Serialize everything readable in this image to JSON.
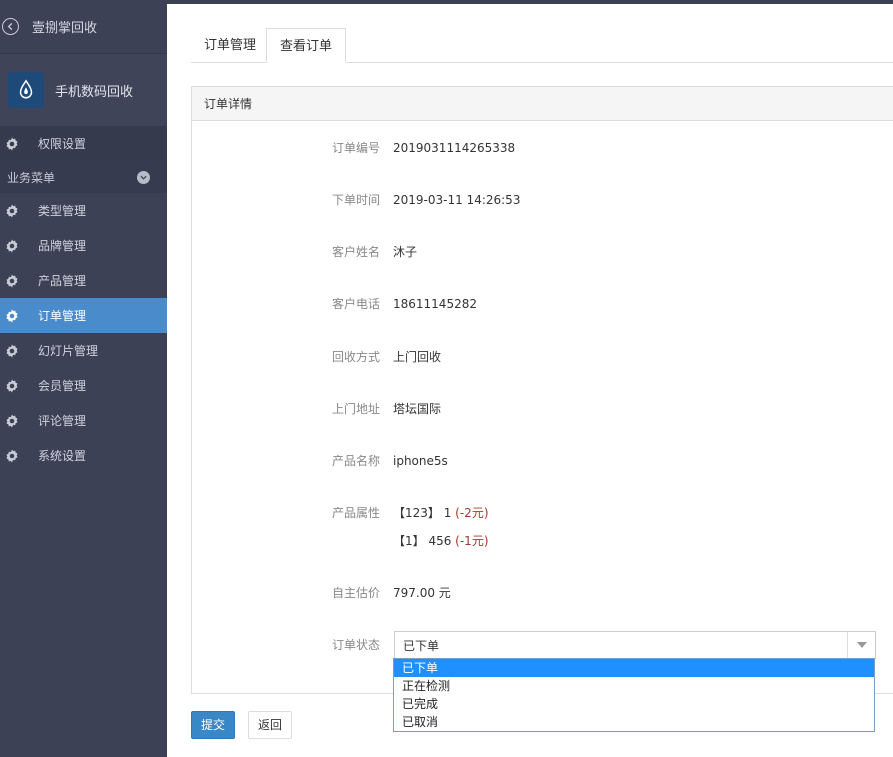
{
  "sidebar": {
    "back_title": "壹捌掌回收",
    "app_name": "手机数码回收",
    "perm_label": "权限设置",
    "section_label": "业务菜单",
    "items": [
      {
        "label": "类型管理"
      },
      {
        "label": "品牌管理"
      },
      {
        "label": "产品管理"
      },
      {
        "label": "订单管理"
      },
      {
        "label": "幻灯片管理"
      },
      {
        "label": "会员管理"
      },
      {
        "label": "评论管理"
      },
      {
        "label": "系统设置"
      }
    ],
    "active_item": "订单管理"
  },
  "tabs": [
    {
      "label": "订单管理"
    },
    {
      "label": "查看订单"
    }
  ],
  "panel": {
    "title": "订单详情",
    "fields": {
      "order_no": {
        "label": "订单编号",
        "value": "2019031114265338"
      },
      "order_time": {
        "label": "下单时间",
        "value": "2019-03-11 14:26:53"
      },
      "customer_name": {
        "label": "客户姓名",
        "value": "沐子"
      },
      "customer_phone": {
        "label": "客户电话",
        "value": "18611145282"
      },
      "recycle_method": {
        "label": "回收方式",
        "value": "上门回收"
      },
      "address": {
        "label": "上门地址",
        "value": "塔坛国际"
      },
      "product_name": {
        "label": "产品名称",
        "value": "iphone5s"
      },
      "product_attr": {
        "label": "产品属性",
        "line1": {
          "name": "【123】 1 ",
          "delta": "(-2元)"
        },
        "line2": {
          "name": "【1】 456 ",
          "delta": "(-1元)"
        }
      },
      "estimate": {
        "label": "自主估价",
        "value": "797.00 元"
      },
      "status": {
        "label": "订单状态",
        "selected": "已下单",
        "options": [
          "已下单",
          "正在检测",
          "已完成",
          "已取消"
        ]
      }
    }
  },
  "buttons": {
    "submit": "提交",
    "back": "返回"
  },
  "colors": {
    "sidebar_bg": "#3c4156",
    "active_bg": "#4a8ccb",
    "price_red": "#cc0000",
    "primary": "#3a87c8"
  }
}
